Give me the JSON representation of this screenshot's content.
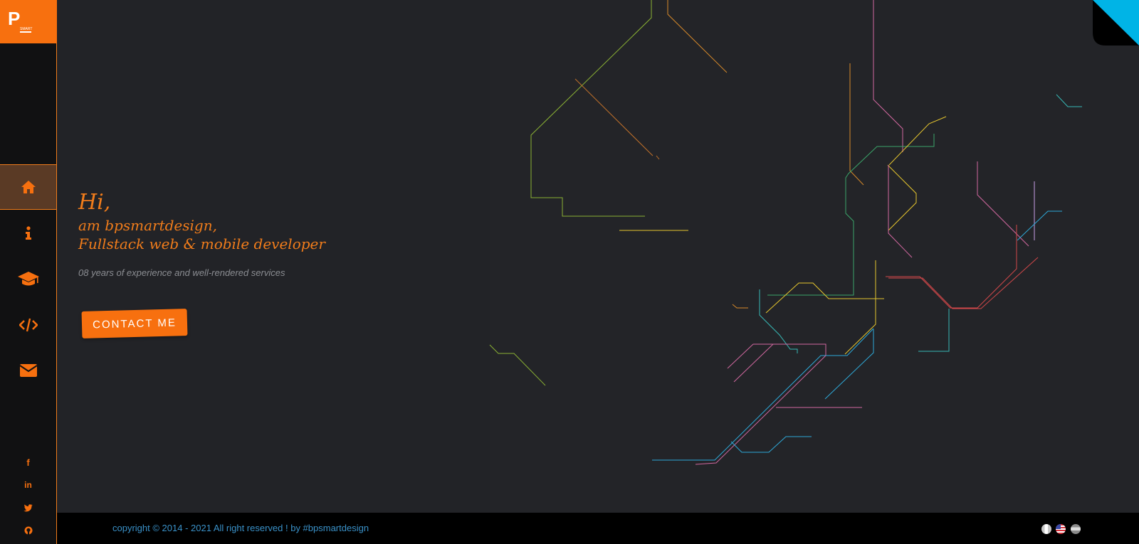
{
  "brand": {
    "logo_letters": "P",
    "logo_small_text": "SMART"
  },
  "nav": [
    {
      "icon": "home-icon",
      "active": true
    },
    {
      "icon": "info-icon",
      "active": false
    },
    {
      "icon": "graduation-cap-icon",
      "active": false
    },
    {
      "icon": "code-icon",
      "active": false
    },
    {
      "icon": "envelope-icon",
      "active": false
    }
  ],
  "social": [
    {
      "icon": "facebook-icon",
      "label": "f"
    },
    {
      "icon": "linkedin-icon",
      "label": "in"
    },
    {
      "icon": "twitter-icon"
    },
    {
      "icon": "github-icon"
    }
  ],
  "hero": {
    "greeting": "Hi,",
    "line2": "am bpsmartdesign,",
    "line3": "Fullstack web & mobile developer",
    "tagline": "08 years of experience and well-rendered services",
    "cta_label": "CONTACT ME"
  },
  "footer": {
    "copyright": "copyright © 2014 - 2021 All right reserved ! by #bpsmartdesign",
    "languages": [
      "fr",
      "en",
      "other"
    ]
  },
  "colors": {
    "accent": "#f7700f",
    "background": "#232428",
    "sidebar": "#111112",
    "footer_text": "#3a91c8",
    "corner": "#00b4e6"
  }
}
